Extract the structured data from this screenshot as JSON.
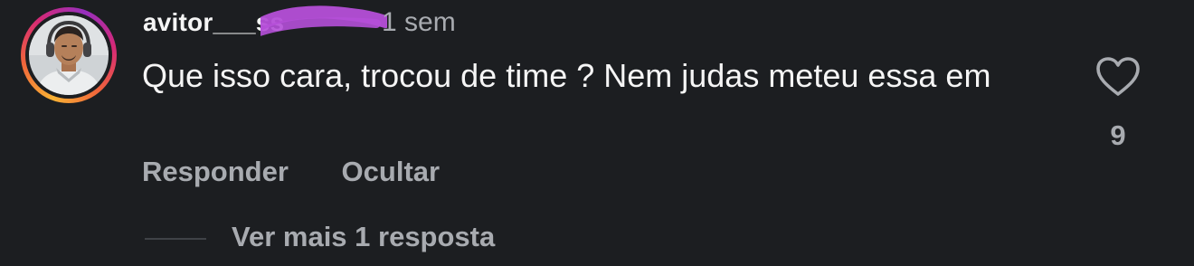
{
  "comment": {
    "username": "avitor___ss",
    "timestamp": "1 sem",
    "text": "Que isso cara, trocou de time ? Nem judas meteu essa em",
    "avatar_icon": "user-avatar-photo",
    "like_icon": "heart-outline-icon",
    "like_count": "9",
    "actions": {
      "reply_label": "Responder",
      "hide_label": "Ocultar"
    },
    "replies": {
      "label": "Ver mais 1 resposta"
    }
  },
  "colors": {
    "background": "#1c1e21",
    "primary_text": "#f5f5f5",
    "secondary_text": "#a8abb0",
    "redaction_mark": "#b54fd8"
  }
}
